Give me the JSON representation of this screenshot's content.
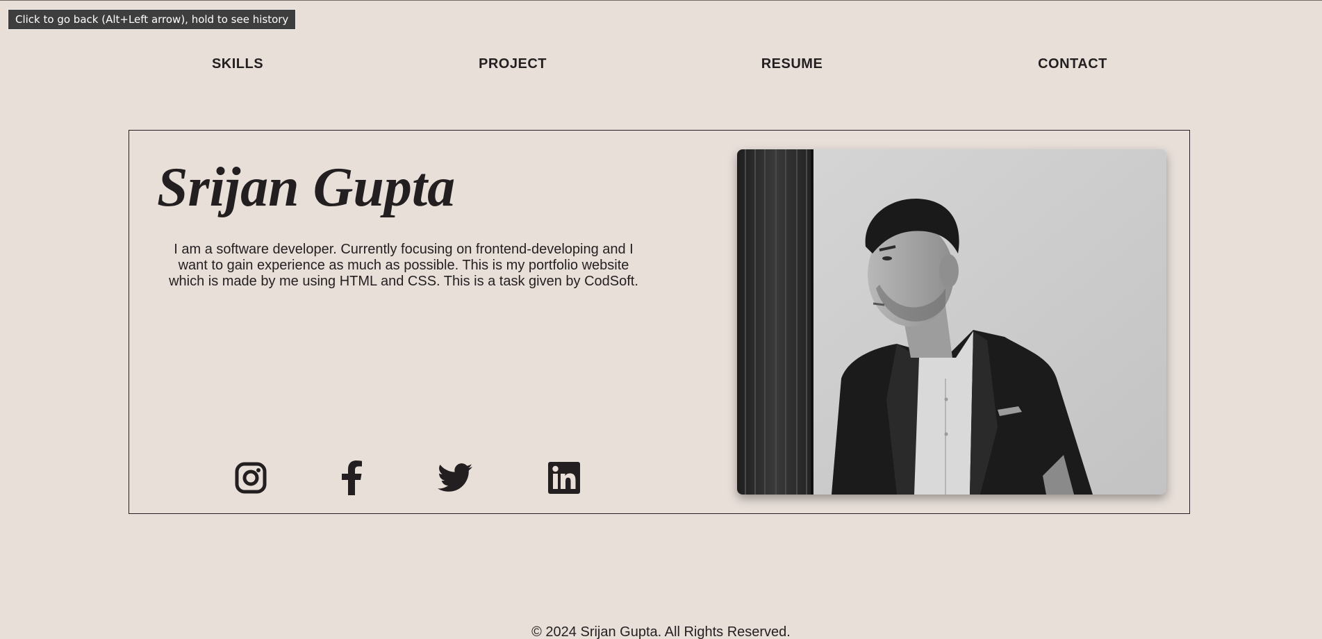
{
  "browser_tooltip": "Click to go back (Alt+Left arrow), hold to see history",
  "nav": {
    "items": [
      {
        "label": "SKILLS"
      },
      {
        "label": "PROJECT"
      },
      {
        "label": "RESUME"
      },
      {
        "label": "CONTACT"
      }
    ]
  },
  "hero": {
    "name": "Srijan Gupta",
    "bio": "I am a software developer. Currently focusing on frontend-developing and I want to gain experience as much as possible. This is my portfolio website which is made by me using HTML and CSS. This is a task given by CodSoft.",
    "socials": [
      {
        "icon": "instagram-icon"
      },
      {
        "icon": "facebook-icon"
      },
      {
        "icon": "twitter-icon"
      },
      {
        "icon": "linkedin-icon"
      }
    ],
    "photo": {
      "subject": "portrait-photo"
    }
  },
  "footer": {
    "copyright": "© 2024 Srijan Gupta. All Rights Reserved."
  },
  "colors": {
    "background": "#e8dfd9",
    "text": "#231f20",
    "border": "#231f20"
  }
}
